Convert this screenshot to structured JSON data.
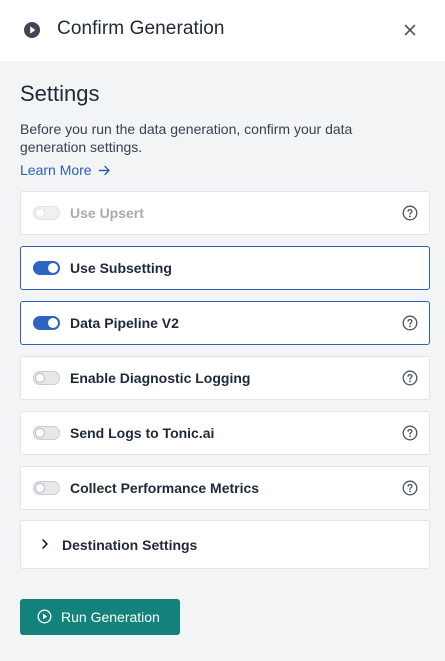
{
  "header": {
    "title": "Confirm Generation",
    "icon": "play-circle-icon",
    "close_icon": "close-icon"
  },
  "settings": {
    "title": "Settings",
    "description": "Before you run the data generation, confirm your data generation settings.",
    "learn_more": "Learn More",
    "options": [
      {
        "label": "Use Upsert",
        "state": "disabled-off",
        "help": true
      },
      {
        "label": "Use Subsetting",
        "state": "on",
        "help": false
      },
      {
        "label": "Data Pipeline V2",
        "state": "on",
        "help": true
      },
      {
        "label": "Enable Diagnostic Logging",
        "state": "off",
        "help": true
      },
      {
        "label": "Send Logs to Tonic.ai",
        "state": "off",
        "help": true
      },
      {
        "label": "Collect Performance Metrics",
        "state": "off",
        "help": true
      }
    ],
    "destination": "Destination Settings"
  },
  "actions": {
    "run_label": "Run Generation"
  },
  "colors": {
    "accent_blue": "#2f5fb3",
    "toggle_on": "#2f63c2",
    "run_button": "#12827a",
    "background": "#f3f4f6"
  }
}
